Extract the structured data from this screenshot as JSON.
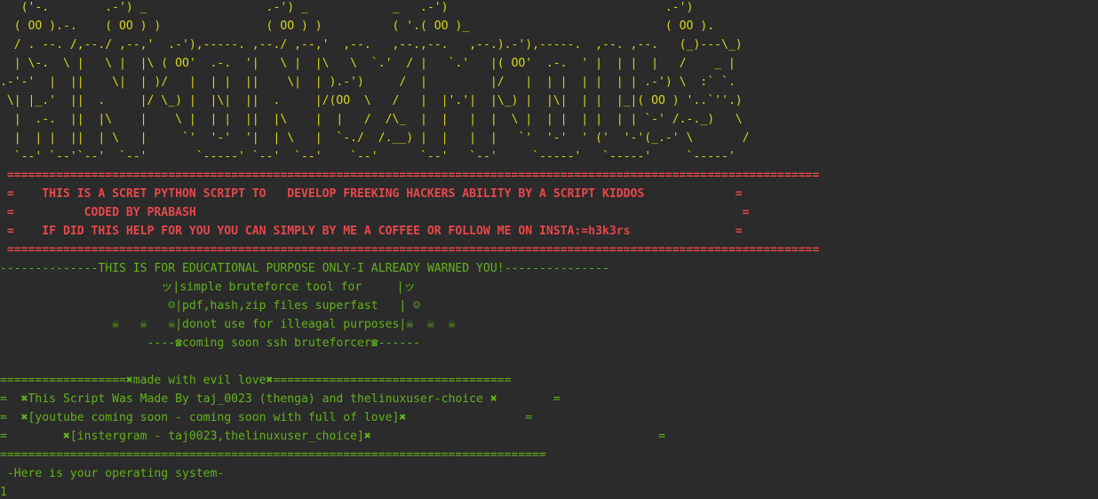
{
  "terminal": {
    "colors": {
      "background": "#2b2b2b",
      "banner": "#d6d61e",
      "warning": "#e8474b",
      "info": "#63b21b"
    },
    "banner_lines": [
      "   ('-.        .-') _                 .-') _            _   .-')                               .-')",
      "  ( OO ).-.    ( OO ) )               ( OO ) )          ( '.( OO )_                            ( OO ).",
      "  / . --. /,--./ ,--,'  .-'),-----. ,--./ ,--,'  ,--.   ,--.,--.   ,--.).-'),-----.  ,--. ,--.   (_)---\\_)",
      "  | \\-.  \\ |   \\ |  |\\ ( OO'  .-.  '|   \\ |  |\\   \\  `.'  / |   `.'   |( OO'  .-.  ' |  | |  |   /    _ |",
      ".-'-'  |  ||    \\|  | )/   |  | |  ||    \\|  | ).-')     /  |         |/   |  | |  | |  | | .-') \\  :` `.",
      " \\| |_.'  ||  .     |/ \\_) |  |\\|  ||  .     |/(OO  \\   /   |  |'.'|  |\\_) |  |\\|  | |  |_|( OO ) '..`''.)",
      "  |  .-.  ||  |\\    |    \\ |  | |  ||  |\\    |  |   /  /\\_  |  |   |  |  \\ |  | |  | |  | | `-' /.-._)   \\",
      "  |  | |  ||  | \\   |     `'  '-'  '|  | \\   |  `-./  /.__) |  |   |  |   `'  '-'  ' ('  '-'(_.-' \\       /",
      "  `--' `--'`--'  `--'       `-----' `--'  `--'    `--'      `--'   `--'     `-----'   `-----'     `-----'"
    ],
    "warning_lines": [
      " ====================================================================================================================",
      " =    THIS IS A SCRET PYTHON SCRIPT TO   DEVELOP FREEKING HACKERS ABILITY BY A SCRIPT KIDDOS             =",
      " =          CODED BY PRABASH                                                                              =",
      " =    IF DID THIS HELP FOR YOU YOU CAN SIMPLY BY ME A COFFEE OR FOLLOW ME ON INSTA:=h3k3rs               =",
      " ===================================================================================================================="
    ],
    "info_lines": [
      "--------------THIS IS FOR EDUCATIONAL PURPOSE ONLY-I ALREADY WARNED YOU!---------------",
      "                       ッ|simple bruteforce tool for     |ッ",
      "                        ☺|pdf,hash,zip files superfast   | ☺",
      "                ☠   ☠   ☠|donot use for illeagal purposes|☠  ☠  ☠",
      "                     ----☎coming soon ssh bruteforcer☎------",
      "",
      "==================✖made with evil love✖==================================",
      "=  ✖This Script Was Made By taj_0023 (thenga) and thelinuxuser-choice ✖        =",
      "=  ✖[youtube coming soon - coming soon with full of love]✖                 =",
      "=        ✖[instergram - taj0023,thelinuxuser_choice]✖                                         =",
      "==============================================================================",
      " -Here is your operating system-",
      "1"
    ]
  }
}
